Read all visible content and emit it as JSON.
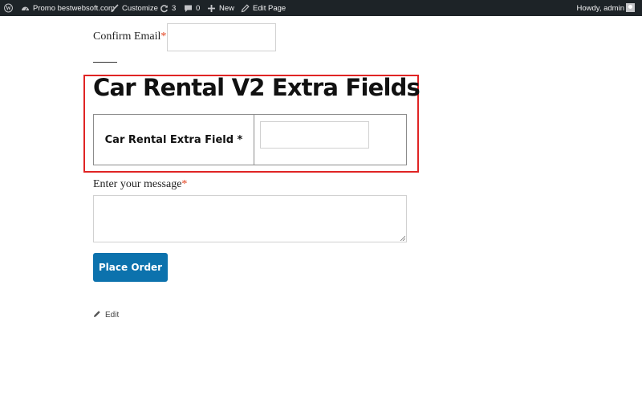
{
  "admin_bar": {
    "site_name": "Promo bestwebsoft.com",
    "customize": "Customize",
    "updates_count": "3",
    "comments_count": "0",
    "new_label": "New",
    "edit_page_label": "Edit Page",
    "greeting": "Howdy, admin",
    "icons": {
      "logo": "wordpress-logo-icon",
      "site": "dashboard-icon",
      "customize": "paintbrush-icon",
      "updates": "refresh-icon",
      "comments": "comment-bubble-icon",
      "new": "plus-icon",
      "edit": "pencil-icon"
    }
  },
  "form": {
    "confirm_email": {
      "label": "Confirm Email",
      "required_mark": "*",
      "value": ""
    },
    "extra_section": {
      "title": "Car Rental V2 Extra Fields",
      "field_label": "Car Rental Extra Field *",
      "value": ""
    },
    "message": {
      "label": "Enter your message",
      "required_mark": "*",
      "value": ""
    },
    "submit_label": "Place Order"
  },
  "footer": {
    "edit_label": "Edit"
  },
  "colors": {
    "admin_bar_bg": "#1d2327",
    "accent_button": "#0c72ad",
    "highlight_border": "#e02424",
    "required": "#e2401c"
  }
}
